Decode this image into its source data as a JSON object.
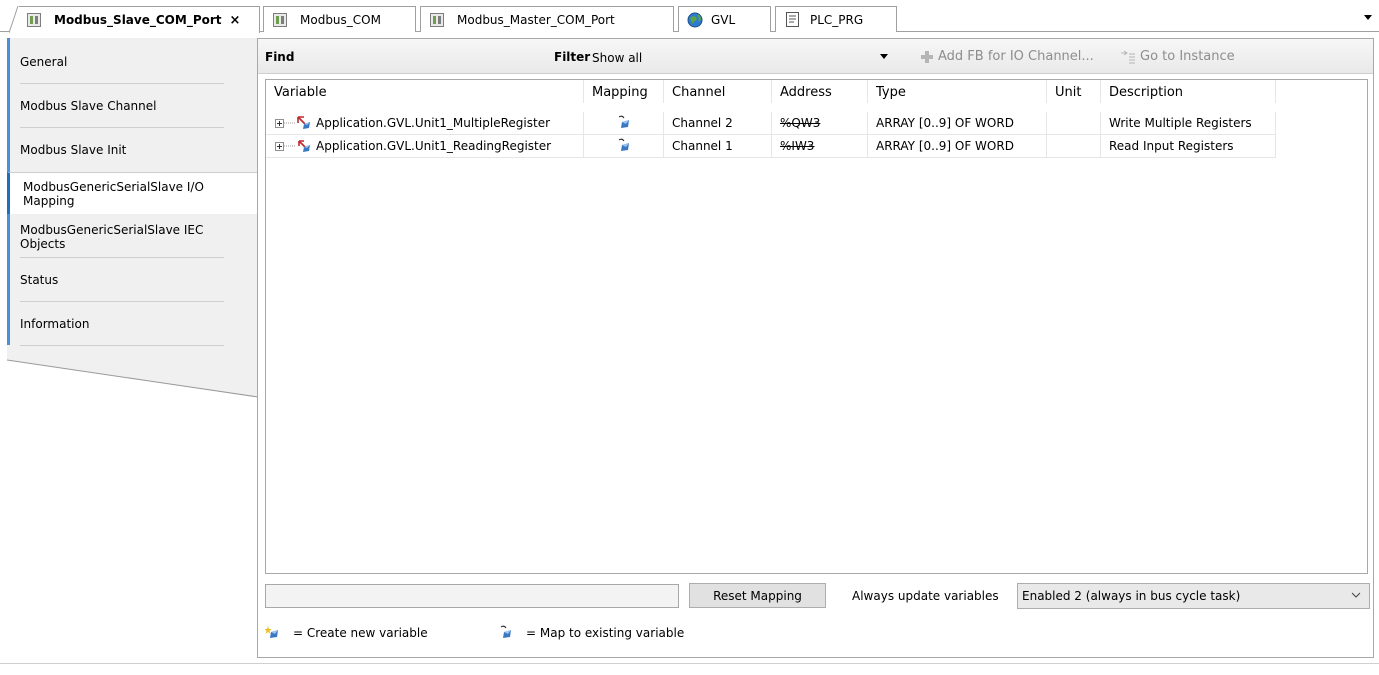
{
  "tabs": [
    {
      "label": "Modbus_Slave_COM_Port",
      "icon": "device-icon",
      "active": true,
      "close": "×"
    },
    {
      "label": "Modbus_COM",
      "icon": "device-icon"
    },
    {
      "label": "Modbus_Master_COM_Port",
      "icon": "device-icon"
    },
    {
      "label": "GVL",
      "icon": "globe-icon"
    },
    {
      "label": "PLC_PRG",
      "icon": "document-icon"
    }
  ],
  "sidenav": {
    "items": [
      {
        "label": "General"
      },
      {
        "label": "Modbus Slave Channel"
      },
      {
        "label": "Modbus Slave Init"
      },
      {
        "label": "ModbusGenericSerialSlave I/O Mapping",
        "line1": "ModbusGenericSerialSlave I/O",
        "line2": "Mapping",
        "selected": true
      },
      {
        "label": "ModbusGenericSerialSlave IEC Objects",
        "line1": "ModbusGenericSerialSlave IEC",
        "line2": "Objects"
      },
      {
        "label": "Status"
      },
      {
        "label": "Information"
      }
    ]
  },
  "toolbar": {
    "find_label": "Find",
    "find_value": "",
    "filter_label": "Filter",
    "filter_value": "Show all",
    "add_fb_label": "Add FB for IO Channel...",
    "goto_label": "Go to Instance"
  },
  "grid": {
    "columns": [
      "Variable",
      "Mapping",
      "Channel",
      "Address",
      "Type",
      "Unit",
      "Description"
    ],
    "rows": [
      {
        "variable": "Application.GVL.Unit1_MultipleRegister",
        "mapping": "map-existing",
        "channel": "Channel 2",
        "address": "%QW3",
        "type": "ARRAY [0..9] OF WORD",
        "unit": "",
        "description": "Write Multiple Registers",
        "direction": "output"
      },
      {
        "variable": "Application.GVL.Unit1_ReadingRegister",
        "mapping": "map-existing",
        "channel": "Channel 1",
        "address": "%IW3",
        "type": "ARRAY [0..9] OF WORD",
        "unit": "",
        "description": "Read Input Registers",
        "direction": "input"
      }
    ]
  },
  "bottom": {
    "reset_label": "Reset Mapping",
    "always_update_label": "Always update variables",
    "update_value": "Enabled 2 (always in bus cycle task)"
  },
  "legend": {
    "create_new": "= Create new variable",
    "map_existing": "= Map to existing variable"
  },
  "colors": {
    "accent_blue": "#4a90d9",
    "nav_bg": "#f0f0f0",
    "output_red": "#c0282d",
    "input_red": "#c0282d",
    "map_blue": "#3a78c2"
  }
}
